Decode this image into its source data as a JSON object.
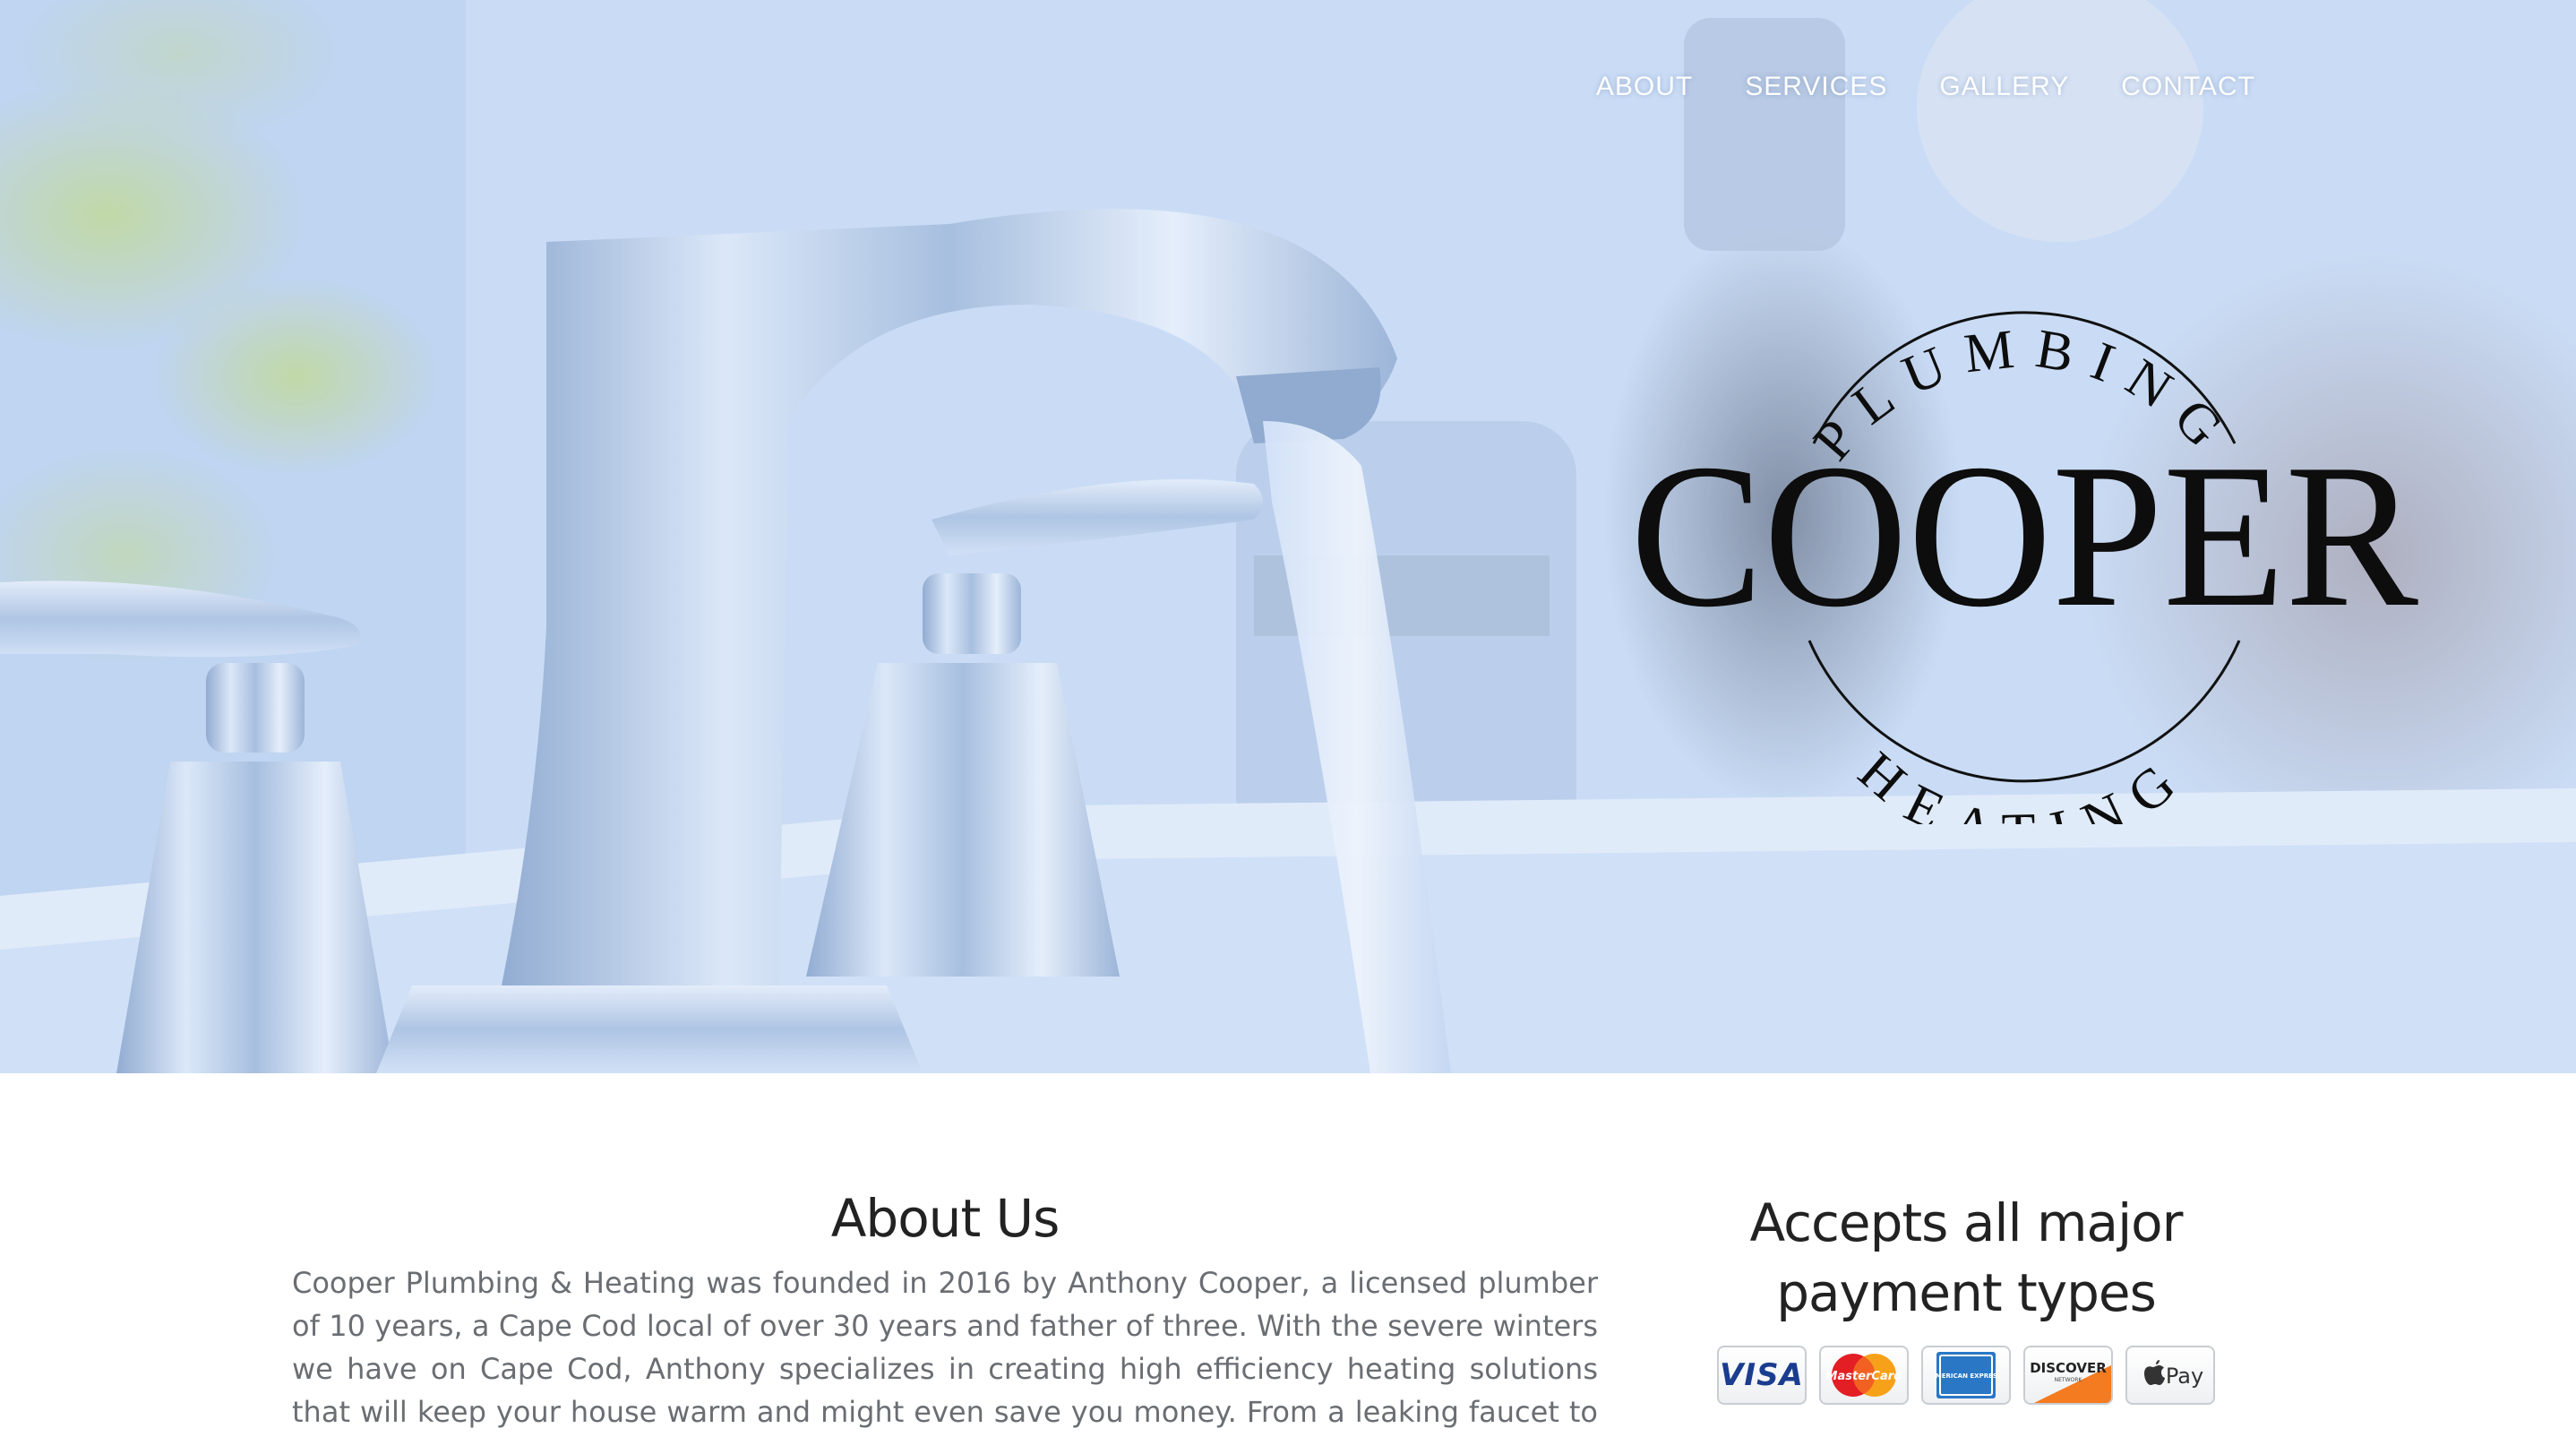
{
  "nav": {
    "items": [
      {
        "label": "ABOUT"
      },
      {
        "label": "SERVICES"
      },
      {
        "label": "GALLERY"
      },
      {
        "label": "CONTACT"
      }
    ]
  },
  "logo": {
    "top_arc": "PLUMBING",
    "name": "COOPER",
    "bottom_arc": "HEATING"
  },
  "about": {
    "title": "About Us",
    "body": "Cooper Plumbing & Heating was founded in 2016 by Anthony Cooper, a licensed plumber of 10 years, a Cape Cod local of over 30 years and father of three. With the severe winters we have on Cape Cod, Anthony specializes in creating high efficiency heating solutions that will keep your house warm and might even save you money. From a leaking faucet to a full bathroom or kitchen"
  },
  "payments": {
    "title": "Accepts all major payment types",
    "cards": [
      {
        "name": "visa-card",
        "label": "VISA",
        "icon": "visa-icon"
      },
      {
        "name": "mastercard-card",
        "label": "MasterCard",
        "icon": "mastercard-icon"
      },
      {
        "name": "amex-card",
        "label": "AMERICAN EXPRESS",
        "icon": "amex-icon"
      },
      {
        "name": "discover-card",
        "label": "DISCOVER",
        "sublabel": "NETWORK",
        "icon": "discover-icon"
      },
      {
        "name": "applepay-card",
        "label": "Pay",
        "icon": "applepay-icon"
      }
    ]
  },
  "colors": {
    "hero_tint": "#c9dbf3",
    "nav_text": "#ffffff",
    "logo_text": "#0d0d0d",
    "heading": "#222222",
    "body_text": "#6a6e73"
  }
}
